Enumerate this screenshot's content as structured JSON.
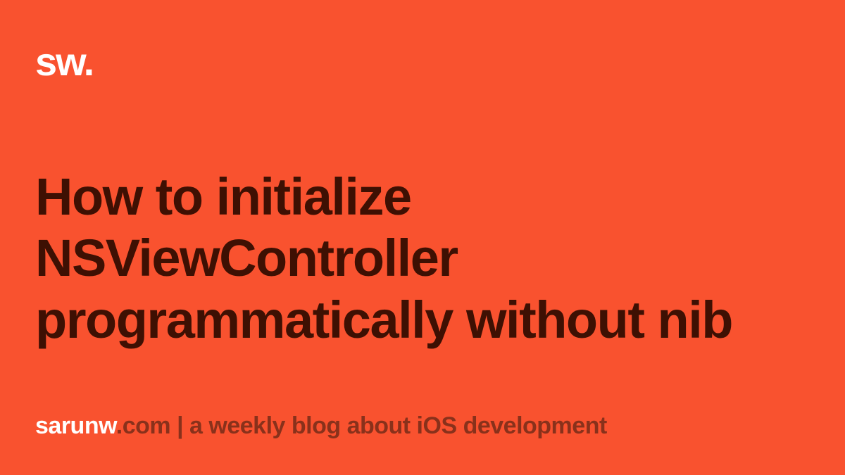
{
  "logo": "sw.",
  "title": "How to initialize NSViewController programmatically without nib",
  "footer": {
    "highlight": "sarunw",
    "rest": ".com | a weekly blog about iOS development"
  },
  "colors": {
    "background": "#F9522F",
    "logo": "#FFFFFF",
    "title": "#3E1003",
    "footer_muted": "#89311B",
    "footer_highlight": "#FFFFFF"
  }
}
